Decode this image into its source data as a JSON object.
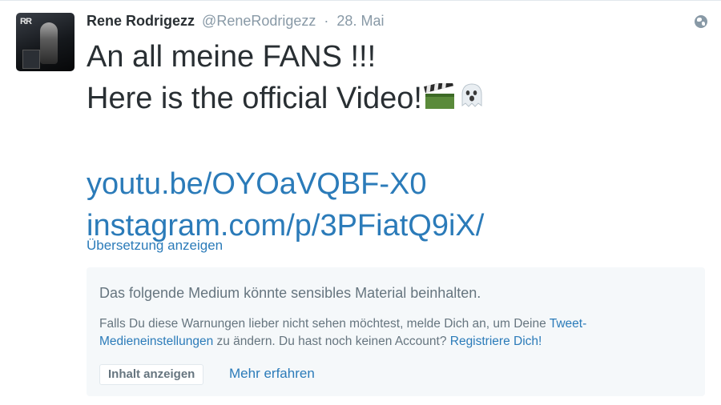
{
  "tweet": {
    "author": {
      "fullname": "Rene Rodrigezz",
      "username": "@ReneRodrigezz",
      "avatar_logo_text": "RR"
    },
    "separator": "·",
    "date": "28. Mai",
    "globe_icon": "globe-icon",
    "text": {
      "line1": "An all meine FANS !!!",
      "line2": "Here is the official Video!",
      "emoji_1": "clapper-board-emoji",
      "emoji_2": "ghost-emoji",
      "link1": "youtu.be/OYOaVQBF-X0",
      "link2": "instagram.com/p/3PFiatQ9iX/"
    },
    "translate_link": "Übersetzung anzeigen",
    "sensitive_media": {
      "title": "Das folgende Medium könnte sensibles Material beinhalten.",
      "body_part1": "Falls Du diese Warnungen lieber nicht sehen möchtest, melde Dich an, um Deine ",
      "settings_link": "Tweet-Medieneinstellungen",
      "body_part2": " zu ändern. Du hast noch keinen Account? ",
      "register_link": "Registriere Dich!",
      "show_button": "Inhalt anzeigen",
      "learn_more": "Mehr erfahren"
    }
  },
  "colors": {
    "link": "#2b7bb9",
    "text": "#292f33",
    "muted": "#8899a6",
    "warning_bg": "#f5f8fa"
  }
}
